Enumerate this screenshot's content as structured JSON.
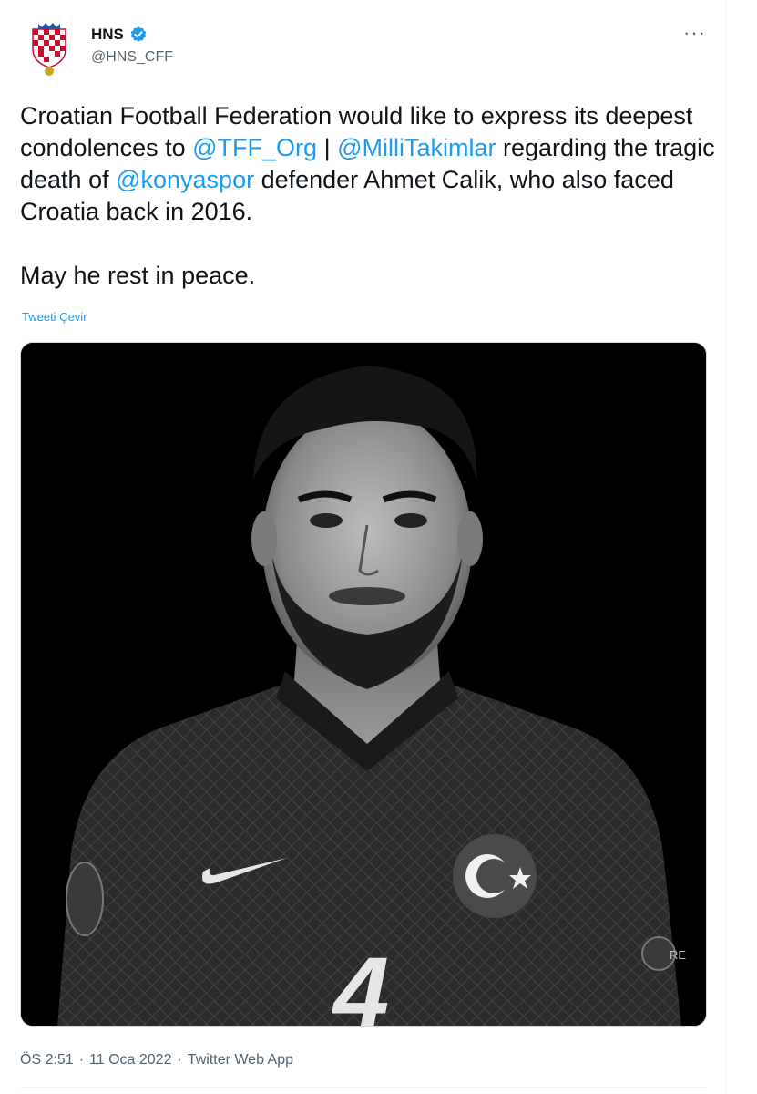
{
  "author": {
    "name": "HNS",
    "handle": "@HNS_CFF"
  },
  "tweet": {
    "text_parts": [
      {
        "t": "Croatian Football Federation would like to express its deepest condolences to ",
        "m": false
      },
      {
        "t": "@TFF_Org",
        "m": true
      },
      {
        "t": " | ",
        "m": false
      },
      {
        "t": "@MilliTakimlar",
        "m": true
      },
      {
        "t": " regarding the tragic death of ",
        "m": false
      },
      {
        "t": "@konyaspor",
        "m": true
      },
      {
        "t": " defender Ahmet Calik, who also faced Croatia back in 2016.\n\nMay he rest in peace.",
        "m": false
      }
    ],
    "translate_label": "Tweeti Çevir"
  },
  "more_label": "···",
  "meta": {
    "time": "ÖS 2:51",
    "sep": "·",
    "date": "11 Oca 2022",
    "app": "Twitter Web App"
  },
  "jersey": {
    "number": "4",
    "patch_text": "RE"
  },
  "colors": {
    "link": "#1d9bf0",
    "verified": "#1d9bf0",
    "secondary_text": "#536471"
  }
}
